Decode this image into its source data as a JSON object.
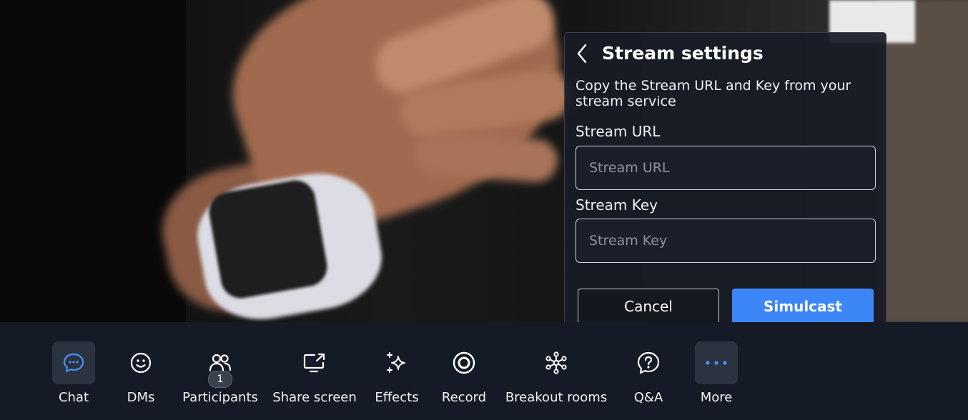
{
  "stream_panel": {
    "title": "Stream settings",
    "description": "Copy the Stream URL and Key from your stream service",
    "url_label": "Stream URL",
    "url_placeholder": "Stream URL",
    "url_value": "",
    "key_label": "Stream Key",
    "key_placeholder": "Stream Key",
    "key_value": "",
    "cancel_label": "Cancel",
    "simulcast_label": "Simulcast",
    "accent_color": "#3d86f7"
  },
  "toolbar": {
    "chat": {
      "label": "Chat",
      "icon": "chat-bubble-icon"
    },
    "dms": {
      "label": "DMs",
      "icon": "smiley-icon"
    },
    "participants": {
      "label": "Participants",
      "icon": "people-icon",
      "count": "1"
    },
    "share_screen": {
      "label": "Share screen",
      "icon": "share-screen-icon"
    },
    "effects": {
      "label": "Effects",
      "icon": "sparkle-icon"
    },
    "record": {
      "label": "Record",
      "icon": "record-icon"
    },
    "breakout": {
      "label": "Breakout rooms",
      "icon": "breakout-icon"
    },
    "qa": {
      "label": "Q&A",
      "icon": "question-icon"
    },
    "more": {
      "label": "More",
      "icon": "more-dots-icon"
    }
  }
}
